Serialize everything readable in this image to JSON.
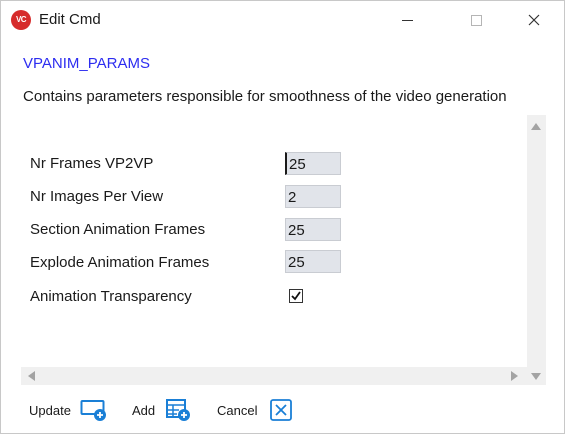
{
  "window": {
    "app_icon_text": "VC",
    "title": "Edit Cmd"
  },
  "command": {
    "name": "VPANIM_PARAMS",
    "description": "Contains parameters responsible for smoothness of the video generation"
  },
  "params": [
    {
      "label": "Nr Frames VP2VP",
      "value": "25"
    },
    {
      "label": "Nr Images Per View",
      "value": "2"
    },
    {
      "label": "Section Animation Frames",
      "value": "25"
    },
    {
      "label": "Explode Animation Frames",
      "value": "25"
    }
  ],
  "checkbox_param": {
    "label": "Animation Transparency",
    "checked": true
  },
  "footer": {
    "update_label": "Update",
    "add_label": "Add",
    "cancel_label": "Cancel"
  },
  "colors": {
    "command_name": "#2d2df0",
    "app_icon": "#d62b2b",
    "button_icon": "#1a7fd6"
  }
}
